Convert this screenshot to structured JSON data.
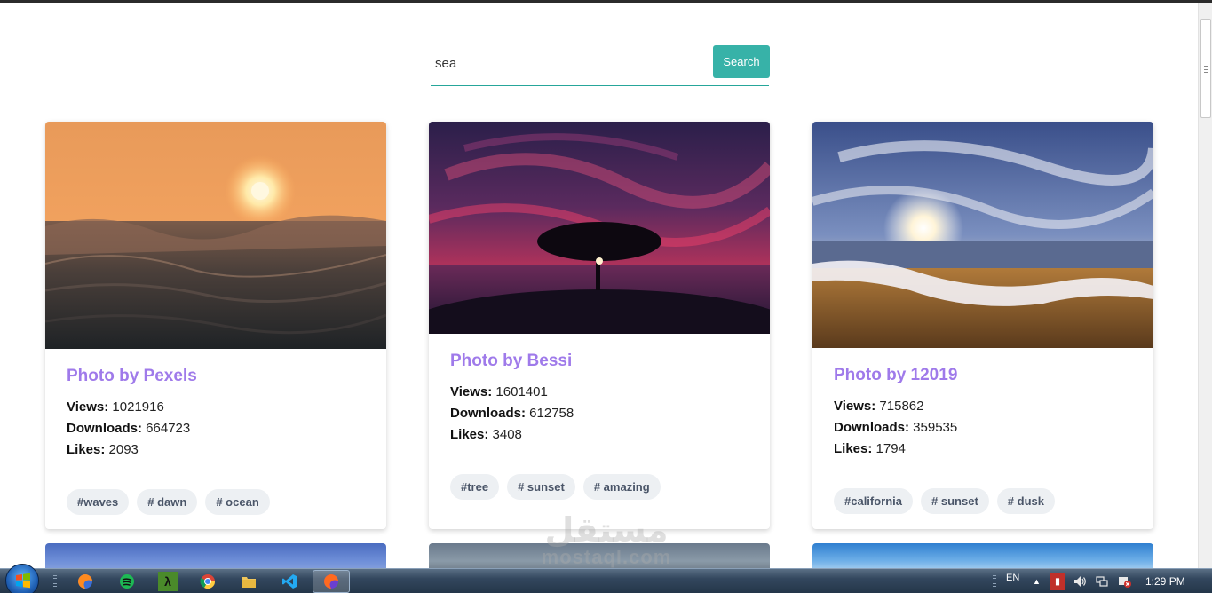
{
  "search": {
    "value": "sea",
    "button_label": "Search"
  },
  "cards": [
    {
      "title": "Photo by Pexels",
      "views_label": "Views:",
      "views": "1021916",
      "downloads_label": "Downloads:",
      "downloads": "664723",
      "likes_label": "Likes:",
      "likes": "2093",
      "tags": [
        "#waves",
        "# dawn",
        "# ocean"
      ]
    },
    {
      "title": "Photo by Bessi",
      "views_label": "Views:",
      "views": "1601401",
      "downloads_label": "Downloads:",
      "downloads": "612758",
      "likes_label": "Likes:",
      "likes": "3408",
      "tags": [
        "#tree",
        "# sunset",
        "# amazing"
      ]
    },
    {
      "title": "Photo by 12019",
      "views_label": "Views:",
      "views": "715862",
      "downloads_label": "Downloads:",
      "downloads": "359535",
      "likes_label": "Likes:",
      "likes": "1794",
      "tags": [
        "#california",
        "# sunset",
        "# dusk"
      ]
    }
  ],
  "watermark": {
    "arabic": "مستقل",
    "latin": "mostaql.com"
  },
  "taskbar": {
    "apps": [
      "firefox-icon",
      "spotify-icon",
      "lambda-icon",
      "chrome-icon",
      "file-explorer-icon",
      "vscode-icon",
      "firefox-icon"
    ],
    "language": "EN",
    "clock": "1:29 PM"
  },
  "colors": {
    "accent": "#37b2a8",
    "title": "#9f7aea",
    "tag_bg": "#edf0f3"
  }
}
